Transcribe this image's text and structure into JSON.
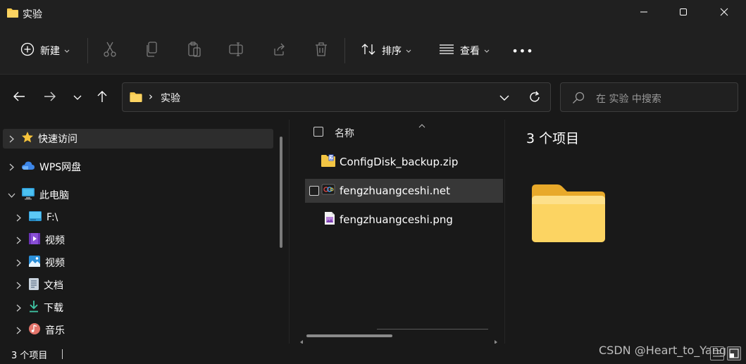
{
  "window": {
    "title": "实验",
    "controls": [
      "minimize-icon",
      "maximize-icon",
      "close-icon"
    ]
  },
  "toolbar": {
    "new_label": "新建",
    "sort_label": "排序",
    "view_label": "查看",
    "more_label": "•••",
    "icons": [
      "cut-icon",
      "copy-icon",
      "paste-icon",
      "rename-icon",
      "share-icon",
      "delete-icon"
    ]
  },
  "address": {
    "separator": "›",
    "path": "实验",
    "search_placeholder": "在 实验 中搜索"
  },
  "sidebar": {
    "items": [
      {
        "label": "快速访问",
        "icon": "star-icon",
        "level": 0
      },
      {
        "label": "WPS网盘",
        "icon": "cloud-icon",
        "level": 0
      },
      {
        "label": "此电脑",
        "icon": "monitor-icon",
        "level": 0
      },
      {
        "label": "F:\\",
        "icon": "drive-icon",
        "level": 1
      },
      {
        "label": "视频",
        "icon": "video-icon",
        "level": 1
      },
      {
        "label": "视频",
        "icon": "picture-icon",
        "level": 1
      },
      {
        "label": "文档",
        "icon": "document-icon",
        "level": 1
      },
      {
        "label": "下载",
        "icon": "download-icon",
        "level": 1
      },
      {
        "label": "音乐",
        "icon": "music-icon",
        "level": 1
      }
    ]
  },
  "filelist": {
    "column_name": "名称",
    "files": [
      {
        "name": "ConfigDisk_backup.zip",
        "icon": "zip-icon"
      },
      {
        "name": "fengzhuangceshi.net",
        "icon": "net-file-icon"
      },
      {
        "name": "fengzhuangceshi.png",
        "icon": "image-file-icon"
      }
    ]
  },
  "details": {
    "count_text": "3 个项目"
  },
  "status": {
    "count_text": "3 个项目",
    "watermark": "CSDN @Heart_to_Yang"
  },
  "colors": {
    "background": "#191919",
    "folder_yellow": "#f8c94a",
    "accent": "#4ea3ff"
  }
}
